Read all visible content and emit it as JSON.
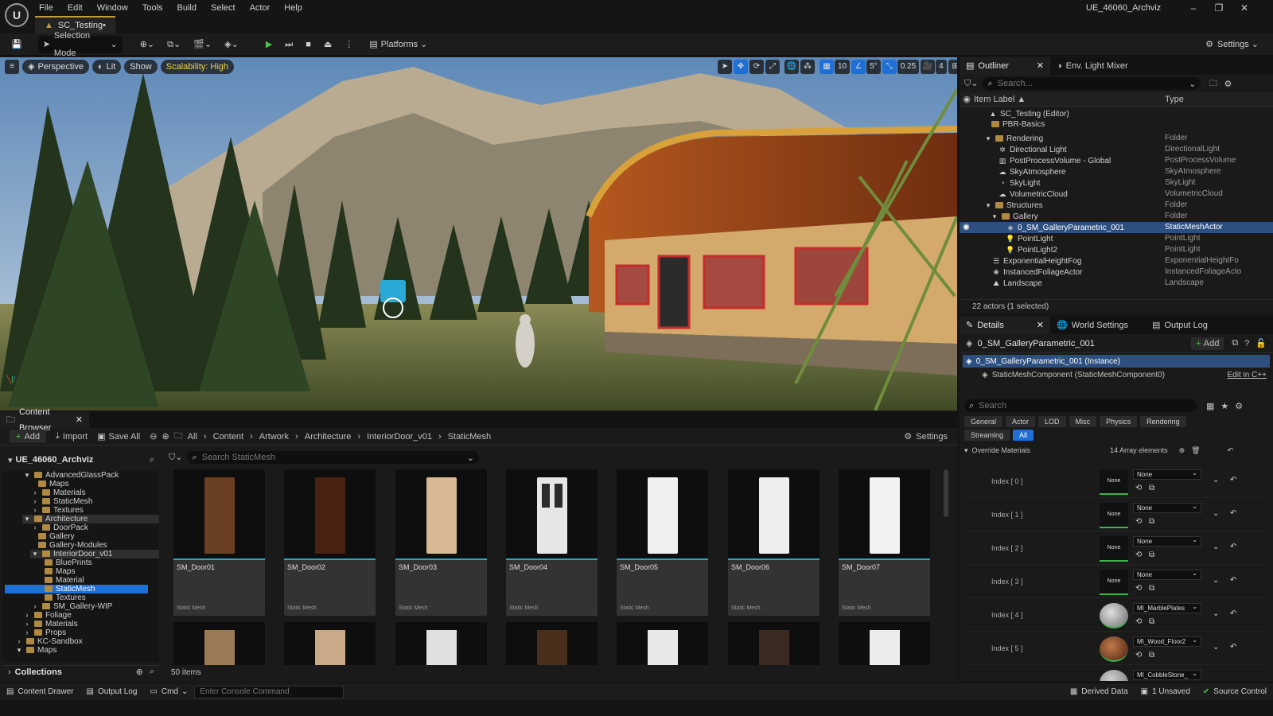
{
  "app": {
    "project_name": "UE_46060_Archviz",
    "logo": "unreal-logo"
  },
  "menubar": [
    "File",
    "Edit",
    "Window",
    "Tools",
    "Build",
    "Select",
    "Actor",
    "Help"
  ],
  "document_tab": "SC_Testing•",
  "toolbar": {
    "selection_mode": "Selection Mode",
    "platforms": "Platforms",
    "settings": "Settings"
  },
  "viewport": {
    "perspective": "Perspective",
    "lit": "Lit",
    "show": "Show",
    "scalability": "Scalability: High",
    "grid_snap": "10",
    "rotation_snap": "5°",
    "scale_snap": "0.25",
    "camera_speed": "4"
  },
  "outliner": {
    "tab": "Outliner",
    "tab2": "Env. Light Mixer",
    "search_placeholder": "Search...",
    "col_label": "Item Label ▲",
    "col_type": "Type",
    "rows": [
      {
        "label": "SC_Testing (Editor)",
        "type": ""
      },
      {
        "label": "PBR-Basics",
        "type": ""
      },
      {
        "label": "Rendering",
        "type": "Folder"
      },
      {
        "label": "Directional Light",
        "type": "DirectionalLight"
      },
      {
        "label": "PostProcessVolume - Global",
        "type": "PostProcessVolume"
      },
      {
        "label": "SkyAtmosphere",
        "type": "SkyAtmosphere"
      },
      {
        "label": "SkyLight",
        "type": "SkyLight"
      },
      {
        "label": "VolumetricCloud",
        "type": "VolumetricCloud"
      },
      {
        "label": "Structures",
        "type": "Folder"
      },
      {
        "label": "Gallery",
        "type": "Folder"
      },
      {
        "label": "0_SM_GalleryParametric_001",
        "type": "StaticMeshActor"
      },
      {
        "label": "PointLight",
        "type": "PointLight"
      },
      {
        "label": "PointLight2",
        "type": "PointLight"
      },
      {
        "label": "ExponentialHeightFog",
        "type": "ExponentialHeightFo"
      },
      {
        "label": "InstancedFoliageActor",
        "type": "InstancedFoliageActo"
      },
      {
        "label": "Landscape",
        "type": "Landscape"
      }
    ],
    "footer": "22 actors (1 selected)"
  },
  "details": {
    "tab": "Details",
    "tab2": "World Settings",
    "tab3": "Output Log",
    "actor_name": "0_SM_GalleryParametric_001",
    "add": "Add",
    "instance": "0_SM_GalleryParametric_001 (Instance)",
    "component": "StaticMeshComponent (StaticMeshComponent0)",
    "edit_cpp": "Edit in C++",
    "search_placeholder": "Search",
    "categories": [
      "General",
      "Actor",
      "LOD",
      "Misc",
      "Physics",
      "Rendering",
      "Streaming",
      "All"
    ],
    "override_title": "Override Materials",
    "array_count": "14 Array elements",
    "materials": [
      {
        "index": "Index [ 0 ]",
        "value": "None",
        "thumb": "None"
      },
      {
        "index": "Index [ 1 ]",
        "value": "None",
        "thumb": "None"
      },
      {
        "index": "Index [ 2 ]",
        "value": "None",
        "thumb": "None"
      },
      {
        "index": "Index [ 3 ]",
        "value": "None",
        "thumb": "None"
      },
      {
        "index": "Index [ 4 ]",
        "value": "MI_MarblePlates",
        "thumb": ""
      },
      {
        "index": "Index [ 5 ]",
        "value": "MI_Wood_Floor2",
        "thumb": ""
      },
      {
        "index": "",
        "value": "MI_CobbleStone_",
        "thumb": ""
      }
    ]
  },
  "content_browser": {
    "tab": "Content Browser",
    "add": "Add",
    "import": "Import",
    "save_all": "Save All",
    "settings": "Settings",
    "breadcrumb": [
      "All",
      "Content",
      "Artwork",
      "Architecture",
      "InteriorDoor_v01",
      "StaticMesh"
    ],
    "tree_root": "UE_46060_Archviz",
    "tree": [
      {
        "label": "AdvancedGlassPack",
        "depth": 3
      },
      {
        "label": "Maps",
        "depth": 4
      },
      {
        "label": "Materials",
        "depth": 4
      },
      {
        "label": "StaticMesh",
        "depth": 4
      },
      {
        "label": "Textures",
        "depth": 4
      },
      {
        "label": "Architecture",
        "depth": 3
      },
      {
        "label": "DoorPack",
        "depth": 4
      },
      {
        "label": "Gallery",
        "depth": 4
      },
      {
        "label": "Gallery-Modules",
        "depth": 4
      },
      {
        "label": "InteriorDoor_v01",
        "depth": 4
      },
      {
        "label": "BluePrints",
        "depth": 5
      },
      {
        "label": "Maps",
        "depth": 5
      },
      {
        "label": "Material",
        "depth": 5
      },
      {
        "label": "StaticMesh",
        "depth": 5
      },
      {
        "label": "Textures",
        "depth": 5
      },
      {
        "label": "SM_Gallery-WIP",
        "depth": 4
      },
      {
        "label": "Foliage",
        "depth": 3
      },
      {
        "label": "Materials",
        "depth": 3
      },
      {
        "label": "Props",
        "depth": 3
      },
      {
        "label": "KC-Sandbox",
        "depth": 2
      },
      {
        "label": "Maps",
        "depth": 2
      }
    ],
    "collections": "Collections",
    "search_placeholder": "Search StaticMesh",
    "assets": [
      {
        "name": "SM_Door01",
        "type": "Static Mesh",
        "color": "#6b3f22"
      },
      {
        "name": "SM_Door02",
        "type": "Static Mesh",
        "color": "#4a2212"
      },
      {
        "name": "SM_Door03",
        "type": "Static Mesh",
        "color": "#d8b994"
      },
      {
        "name": "SM_Door04",
        "type": "Static Mesh",
        "color": "#e6e6e6"
      },
      {
        "name": "SM_Door05",
        "type": "Static Mesh",
        "color": "#f0f0f0"
      },
      {
        "name": "SM_Door06",
        "type": "Static Mesh",
        "color": "#eeeeee"
      },
      {
        "name": "SM_Door07",
        "type": "Static Mesh",
        "color": "#f2f2f2"
      }
    ],
    "row2_colors": [
      "#9b7a55",
      "#c9a987",
      "#e0e0e0",
      "#4a2e1c",
      "#e8e8e8",
      "#3a2a22",
      "#ececec"
    ],
    "item_count": "50 items"
  },
  "statusbar": {
    "drawer": "Content Drawer",
    "output_log": "Output Log",
    "cmd": "Cmd",
    "console_placeholder": "Enter Console Command",
    "derived": "Derived Data",
    "unsaved": "1 Unsaved",
    "source": "Source Control"
  },
  "colors": {
    "accent": "#1e6fd6",
    "selection": "#2c4f80",
    "folder": "#b08a42",
    "highlight_yellow": "#f2d24a"
  }
}
